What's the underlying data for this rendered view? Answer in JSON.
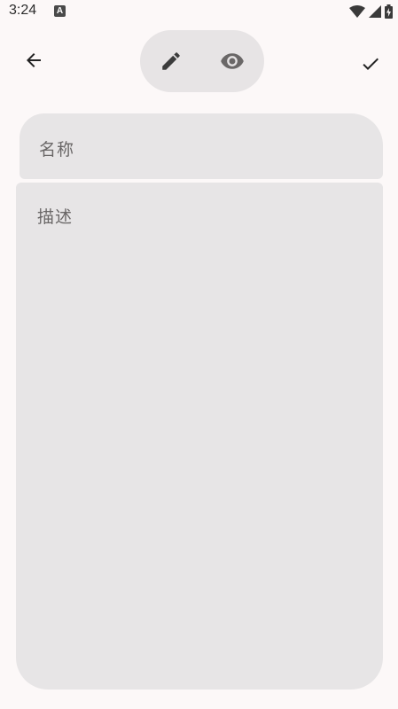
{
  "status_bar": {
    "time": "3:24",
    "app_indicator": "A",
    "icons": [
      "wifi-icon",
      "signal-icon",
      "battery-charging-icon"
    ]
  },
  "toolbar": {
    "back_icon": "arrow-left-icon",
    "confirm_icon": "check-icon",
    "mode_toggle": {
      "edit_icon": "pencil-icon",
      "preview_icon": "eye-icon"
    }
  },
  "form": {
    "name_placeholder": "名称",
    "description_placeholder": "描述"
  },
  "colors": {
    "background": "#fcf8f8",
    "field_background": "#e7e5e6",
    "icon": "#222222",
    "placeholder": "#6a6767"
  }
}
